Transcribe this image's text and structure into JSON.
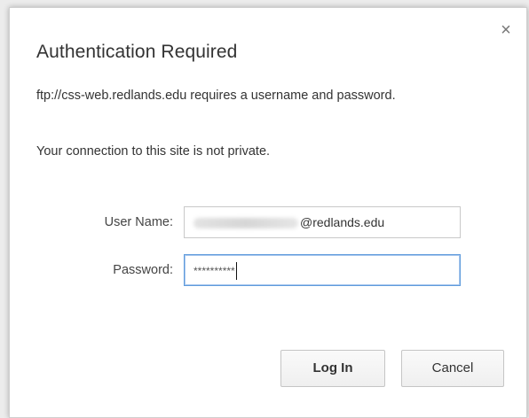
{
  "dialog": {
    "title": "Authentication Required",
    "message": "ftp://css-web.redlands.edu requires a username and password.",
    "privacy_note": "Your connection to this site is not private.",
    "close_glyph": "×"
  },
  "form": {
    "username_label": "User Name:",
    "username_value_suffix": "@redlands.edu",
    "password_label": "Password:",
    "password_value": "**********"
  },
  "buttons": {
    "login_label": "Log In",
    "cancel_label": "Cancel"
  },
  "colors": {
    "focus_border": "#5f9bdc",
    "background": "#ffffff",
    "page_bg": "#ececec"
  }
}
